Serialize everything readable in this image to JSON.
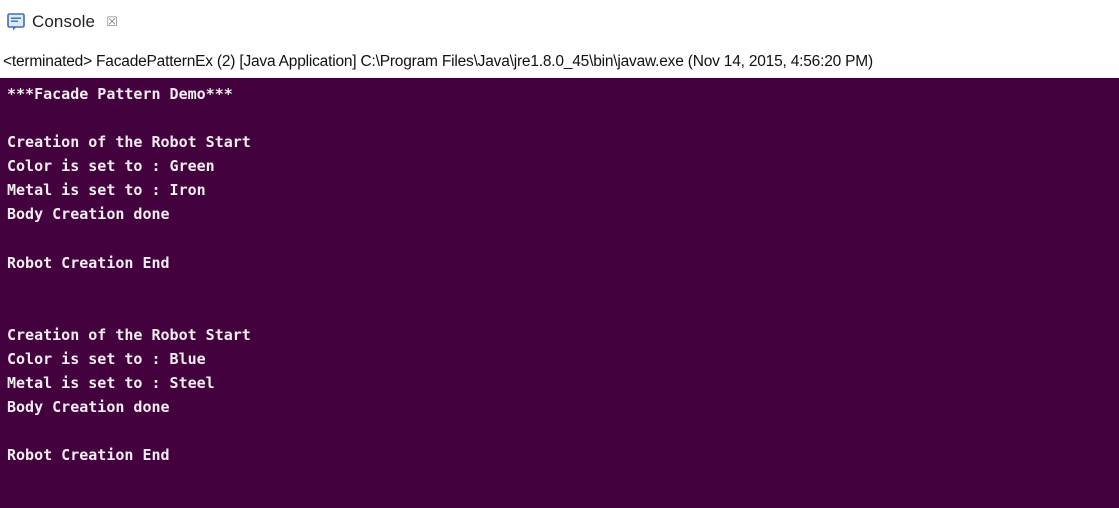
{
  "tab": {
    "icon": "console-icon",
    "label": "Console",
    "close_glyph": "☒"
  },
  "status": {
    "text": "<terminated> FacadePatternEx (2) [Java Application] C:\\Program Files\\Java\\jre1.8.0_45\\bin\\javaw.exe (Nov 14, 2015, 4:56:20 PM)"
  },
  "colors": {
    "console_background": "#43013e",
    "console_text": "#f4eef3"
  },
  "output": {
    "lines": [
      "***Facade Pattern Demo***",
      "",
      "Creation of the Robot Start",
      "Color is set to : Green",
      "Metal is set to : Iron",
      "Body Creation done",
      "",
      "Robot Creation End",
      "",
      "",
      "Creation of the Robot Start",
      "Color is set to : Blue",
      "Metal is set to : Steel",
      "Body Creation done",
      "",
      "Robot Creation End"
    ]
  }
}
